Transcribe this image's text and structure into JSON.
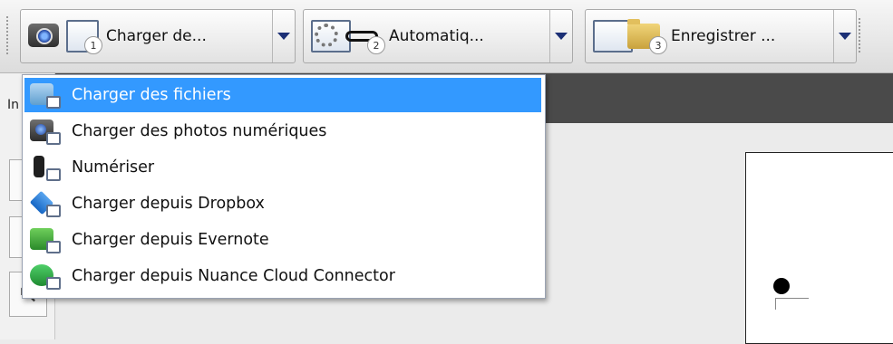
{
  "toolbar": {
    "groups": [
      {
        "label": "Charger de...",
        "step": "1"
      },
      {
        "label": "Automatiq...",
        "step": "2"
      },
      {
        "label": "Enregistrer ...",
        "step": "3"
      }
    ]
  },
  "left_panel": {
    "tab_label": "In"
  },
  "menu": {
    "items": [
      {
        "label": "Charger des fichiers",
        "icon": "folder-upload-icon",
        "selected": true
      },
      {
        "label": "Charger des photos numériques",
        "icon": "camera-icon",
        "selected": false
      },
      {
        "label": "Numériser",
        "icon": "scanner-icon",
        "selected": false
      },
      {
        "label": "Charger depuis Dropbox",
        "icon": "dropbox-icon",
        "selected": false
      },
      {
        "label": "Charger depuis Evernote",
        "icon": "evernote-icon",
        "selected": false
      },
      {
        "label": "Charger depuis Nuance Cloud Connector",
        "icon": "nuance-cloud-icon",
        "selected": false
      }
    ]
  },
  "colors": {
    "selection": "#3399ff",
    "dark_bar": "#4a4a4a",
    "dropdown_arrow": "#1b2f75"
  }
}
